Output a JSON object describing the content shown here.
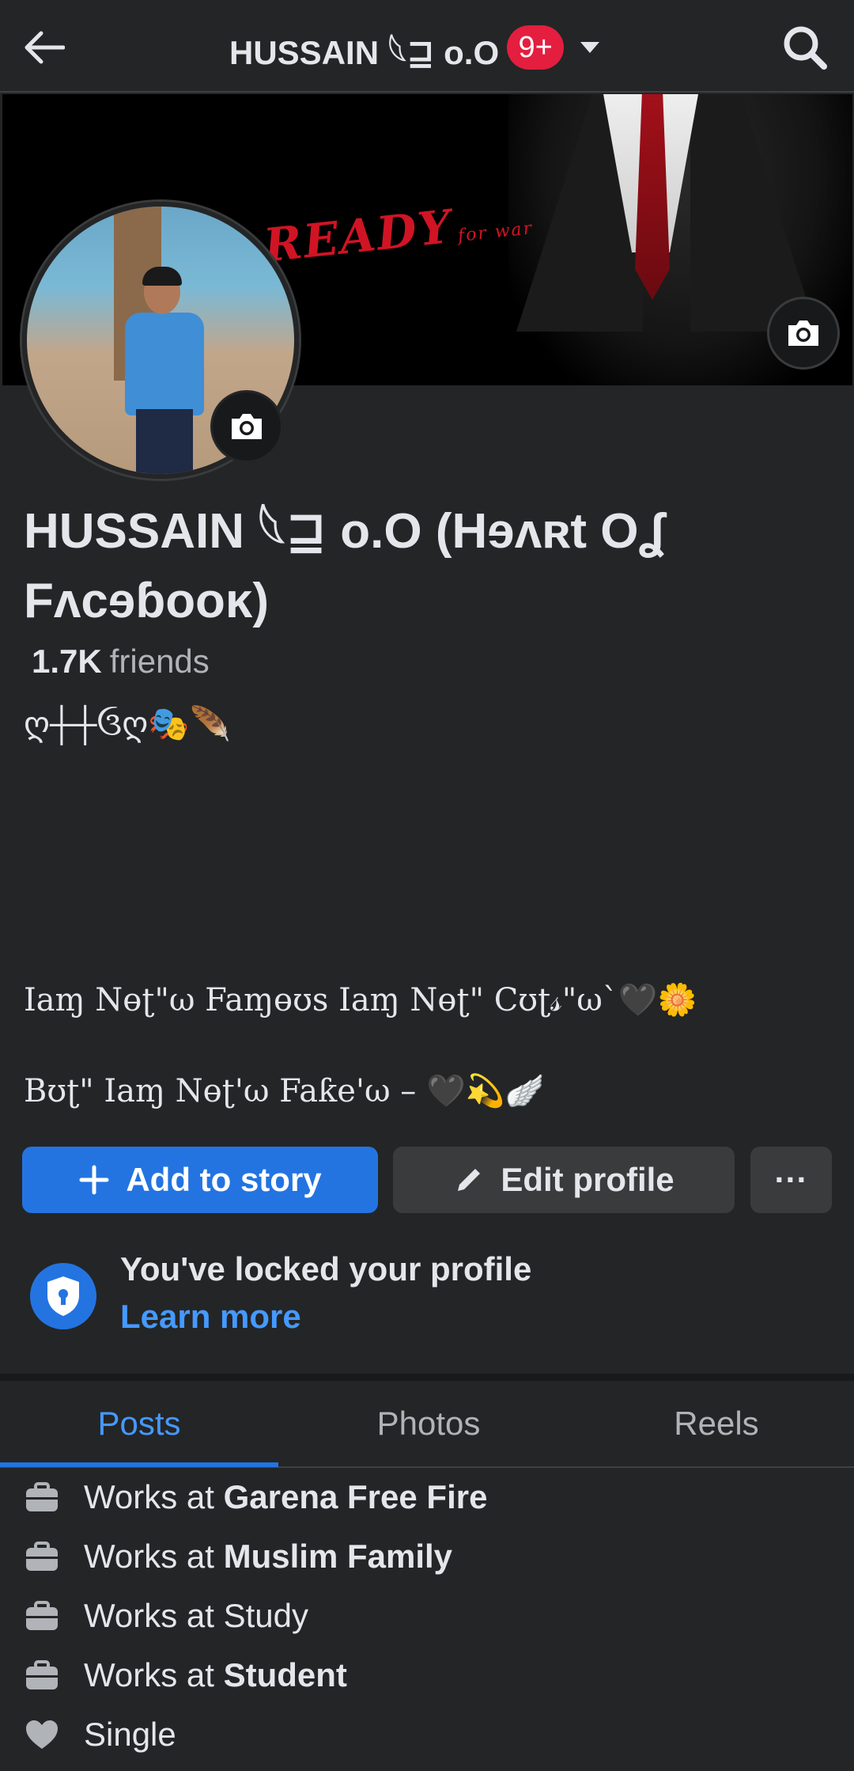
{
  "header": {
    "title": "HUSSAIN 𓆩⊒ o.O",
    "notification_badge": "9+"
  },
  "cover": {
    "text": "READY",
    "subtext": "for war"
  },
  "profile": {
    "name": "HUSSAIN 𓆩⊒ o.O (Hɘʌʀt Oʆ Fʌcɘɓooĸ)",
    "friends_count": "1.7K",
    "friends_label": "friends",
    "bio_line_1": "ღ┼┼ઉღ🎭🪶",
    "bio_line_2": "Iaɱ Nɵʈ\"ω Faɱɵʊs Iaɱ Nɵʈ\" Cʊʈ𝓈\"ω`🖤🌼",
    "bio_line_3": "Bʊʈ\" Iaɱ Nɵʈ'ω Faƙe'ω  – 🖤💫🪽"
  },
  "actions": {
    "add_story": "Add to story",
    "edit_profile": "Edit profile",
    "more": "···"
  },
  "lock_notice": {
    "title": "You've locked your profile",
    "link": "Learn more"
  },
  "tabs": [
    {
      "label": "Posts"
    },
    {
      "label": "Photos"
    },
    {
      "label": "Reels"
    }
  ],
  "details": [
    {
      "prefix": "Works at",
      "value": "Garena Free Fire"
    },
    {
      "prefix": "Works at",
      "value": "Muslim Family"
    },
    {
      "prefix": "Works at Study",
      "value": ""
    },
    {
      "prefix": "Works at",
      "value": "Student"
    },
    {
      "prefix": "Single",
      "value": ""
    }
  ],
  "colors": {
    "background": "#242526",
    "accent": "#2374e1",
    "link": "#4599ff",
    "badge": "#e41e3f"
  }
}
